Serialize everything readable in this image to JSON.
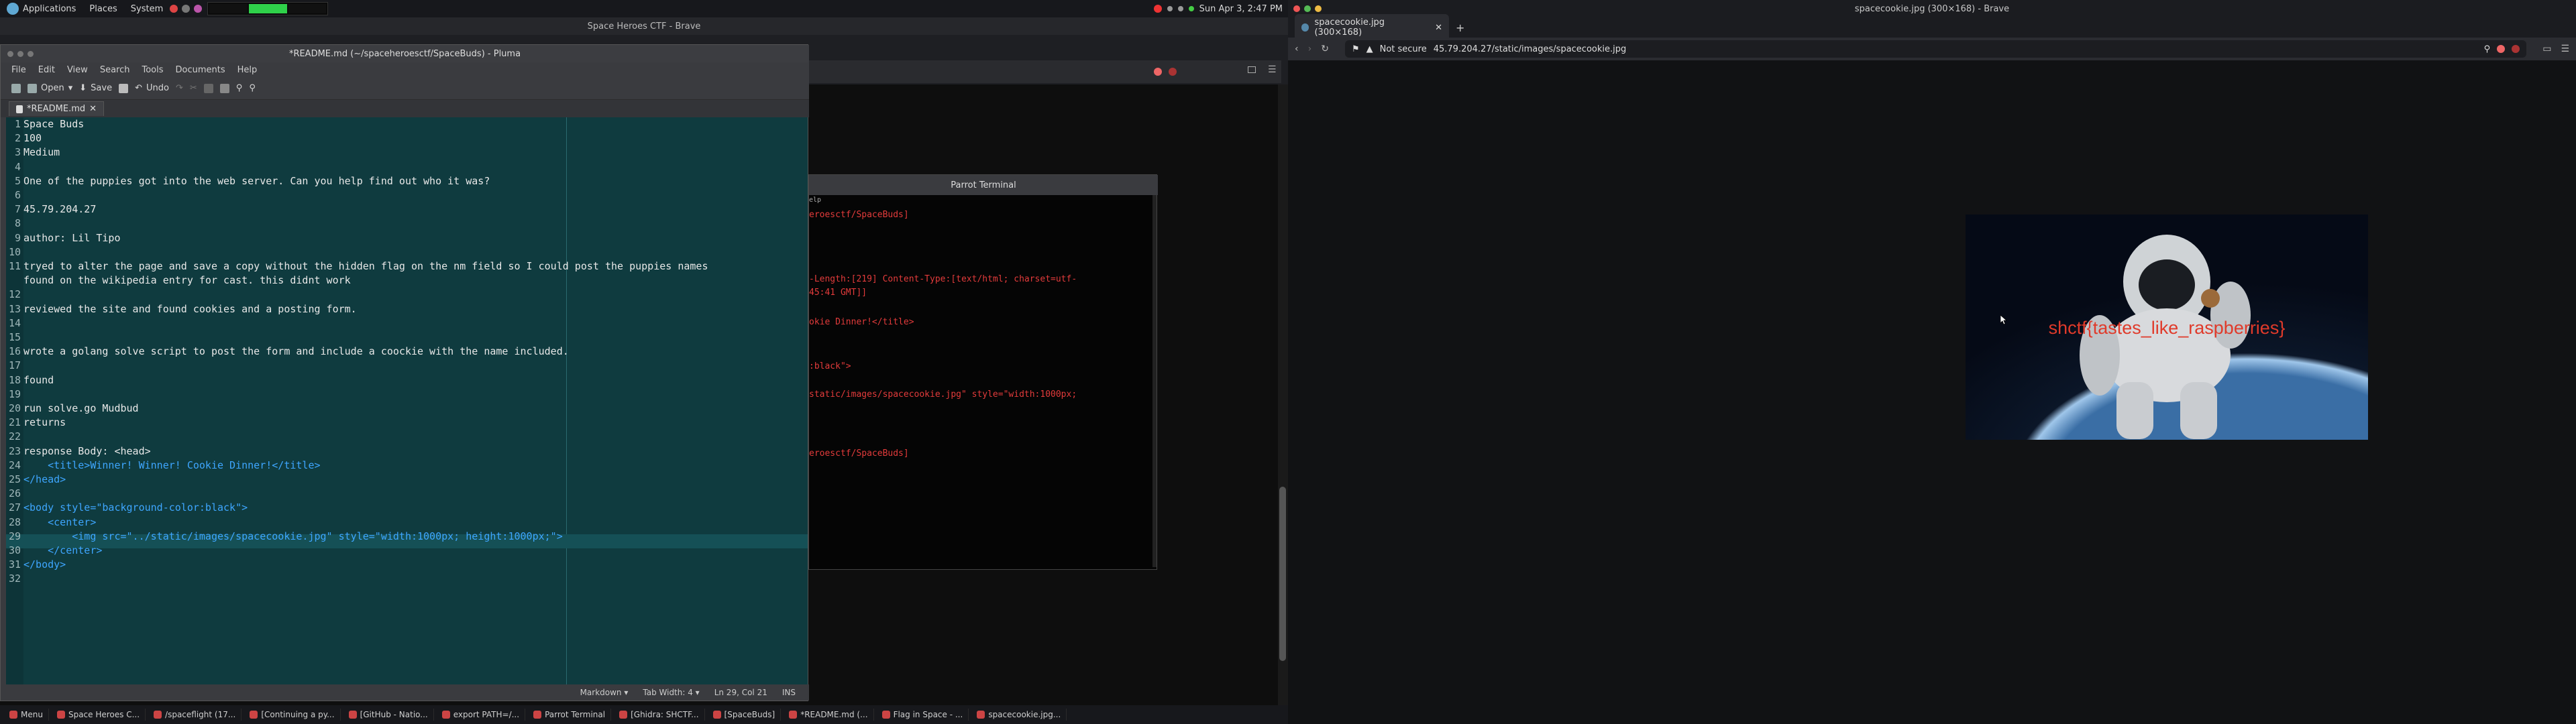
{
  "top_panel": {
    "menus": [
      "Applications",
      "Places",
      "System"
    ],
    "clock": "Sun Apr 3,  2:47 PM"
  },
  "left_browser": {
    "window_title": "Space Heroes CTF - Brave"
  },
  "right_browser": {
    "window_title": "spacecookie.jpg (300×168) - Brave",
    "tab_label": "spacecookie.jpg (300×168)",
    "new_tab": "+",
    "url_status": "Not secure",
    "url": "45.79.204.27/static/images/spacecookie.jpg",
    "image_overlay_text": "shctf{tastes_like_raspberries}"
  },
  "pluma": {
    "window_title": "*README.md (~/spaceheroesctf/SpaceBuds) - Pluma",
    "menus": [
      "File",
      "Edit",
      "View",
      "Search",
      "Tools",
      "Documents",
      "Help"
    ],
    "toolbar": {
      "open": "Open",
      "save": "Save",
      "undo": "Undo"
    },
    "tab_label": "*README.md",
    "status": {
      "lang": "Markdown",
      "tab_width": "Tab Width: 4",
      "pos": "Ln 29, Col 21",
      "mode": "INS"
    },
    "lines": [
      {
        "n": "1",
        "t": "Space Buds"
      },
      {
        "n": "2",
        "t": "100"
      },
      {
        "n": "3",
        "t": "Medium"
      },
      {
        "n": "4",
        "t": ""
      },
      {
        "n": "5",
        "t": "One of the puppies got into the web server. Can you help find out who it was?"
      },
      {
        "n": "6",
        "t": ""
      },
      {
        "n": "7",
        "t": "45.79.204.27"
      },
      {
        "n": "8",
        "t": ""
      },
      {
        "n": "9",
        "t": "author: Lil Tipo"
      },
      {
        "n": "10",
        "t": ""
      },
      {
        "n": "11",
        "t": "tryed to alter the page and save a copy without the hidden flag on the nm field so I could post the puppies names"
      },
      {
        "n": "",
        "t": "found on the wikipedia entry for cast. this didnt work"
      },
      {
        "n": "12",
        "t": ""
      },
      {
        "n": "13",
        "t": "reviewed the site and found cookies and a posting form."
      },
      {
        "n": "14",
        "t": ""
      },
      {
        "n": "15",
        "t": ""
      },
      {
        "n": "16",
        "t": "wrote a golang solve script to post the form and include a coockie with the name included."
      },
      {
        "n": "17",
        "t": ""
      },
      {
        "n": "18",
        "t": "found"
      },
      {
        "n": "19",
        "t": ""
      },
      {
        "n": "20",
        "t": "run solve.go Mudbud"
      },
      {
        "n": "21",
        "t": "returns"
      },
      {
        "n": "22",
        "t": ""
      },
      {
        "n": "23",
        "t": "response Body: <head>"
      },
      {
        "n": "24",
        "t": "    <title>Winner! Winner! Cookie Dinner!</title>"
      },
      {
        "n": "25",
        "t": "</head>"
      },
      {
        "n": "26",
        "t": ""
      },
      {
        "n": "27",
        "t": "<body style=\"background-color:black\">"
      },
      {
        "n": "28",
        "t": "    <center>"
      },
      {
        "n": "29",
        "t": "        <img src=\"../static/images/spacecookie.jpg\" style=\"width:1000px; height:1000px;\">"
      },
      {
        "n": "30",
        "t": "    </center>"
      },
      {
        "n": "31",
        "t": "</body>"
      },
      {
        "n": "32",
        "t": ""
      }
    ]
  },
  "terminal": {
    "title": "Parrot Terminal",
    "menu_frag": "elp",
    "lines": [
      {
        "c": "red",
        "t": "eroesctf/SpaceBuds]"
      },
      {
        "c": "red",
        "t": "-Length:[219] Content-Type:[text/html; charset=utf-"
      },
      {
        "c": "red",
        "t": "45:41 GMT]]"
      },
      {
        "c": "red",
        "t": "okie Dinner!</title>"
      },
      {
        "c": "red",
        "t": ":black\">"
      },
      {
        "c": "red",
        "t": "static/images/spacecookie.jpg\" style=\"width:1000px;"
      },
      {
        "c": "red",
        "t": "eroesctf/SpaceBuds]"
      }
    ]
  },
  "taskbar": {
    "items": [
      "Menu",
      "Space Heroes C...",
      "/spaceflight (17...",
      "[Continuing a py...",
      "[GitHub - Natio...",
      "export PATH=/...",
      "Parrot Terminal",
      "[Ghidra: SHCTF...",
      "[SpaceBuds]",
      "*README.md (...",
      "Flag in Space - ...",
      "spacecookie.jpg..."
    ]
  }
}
